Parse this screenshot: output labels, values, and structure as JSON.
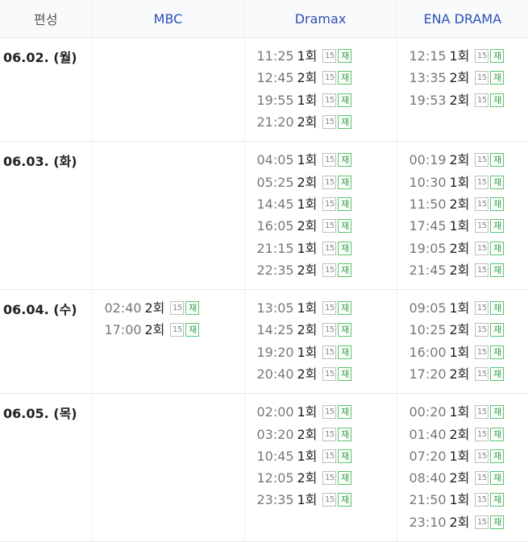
{
  "header": {
    "program": "편성",
    "channels": [
      "MBC",
      "Dramax",
      "ENA DRAMA"
    ]
  },
  "rows": [
    {
      "date": "06.02. (월)",
      "cells": [
        [],
        [
          {
            "time": "11:25",
            "ep": "1회",
            "age": "15",
            "rerun": "재"
          },
          {
            "time": "12:45",
            "ep": "2회",
            "age": "15",
            "rerun": "재"
          },
          {
            "time": "19:55",
            "ep": "1회",
            "age": "15",
            "rerun": "재"
          },
          {
            "time": "21:20",
            "ep": "2회",
            "age": "15",
            "rerun": "재"
          }
        ],
        [
          {
            "time": "12:15",
            "ep": "1회",
            "age": "15",
            "rerun": "재"
          },
          {
            "time": "13:35",
            "ep": "2회",
            "age": "15",
            "rerun": "재"
          },
          {
            "time": "19:53",
            "ep": "2회",
            "age": "15",
            "rerun": "재"
          }
        ]
      ]
    },
    {
      "date": "06.03. (화)",
      "cells": [
        [],
        [
          {
            "time": "04:05",
            "ep": "1회",
            "age": "15",
            "rerun": "재"
          },
          {
            "time": "05:25",
            "ep": "2회",
            "age": "15",
            "rerun": "재"
          },
          {
            "time": "14:45",
            "ep": "1회",
            "age": "15",
            "rerun": "재"
          },
          {
            "time": "16:05",
            "ep": "2회",
            "age": "15",
            "rerun": "재"
          },
          {
            "time": "21:15",
            "ep": "1회",
            "age": "15",
            "rerun": "재"
          },
          {
            "time": "22:35",
            "ep": "2회",
            "age": "15",
            "rerun": "재"
          }
        ],
        [
          {
            "time": "00:19",
            "ep": "2회",
            "age": "15",
            "rerun": "재"
          },
          {
            "time": "10:30",
            "ep": "1회",
            "age": "15",
            "rerun": "재"
          },
          {
            "time": "11:50",
            "ep": "2회",
            "age": "15",
            "rerun": "재"
          },
          {
            "time": "17:45",
            "ep": "1회",
            "age": "15",
            "rerun": "재"
          },
          {
            "time": "19:05",
            "ep": "2회",
            "age": "15",
            "rerun": "재"
          },
          {
            "time": "21:45",
            "ep": "2회",
            "age": "15",
            "rerun": "재"
          }
        ]
      ]
    },
    {
      "date": "06.04. (수)",
      "cells": [
        [
          {
            "time": "02:40",
            "ep": "2회",
            "age": "15",
            "rerun": "재"
          },
          {
            "time": "17:00",
            "ep": "2회",
            "age": "15",
            "rerun": "재"
          }
        ],
        [
          {
            "time": "13:05",
            "ep": "1회",
            "age": "15",
            "rerun": "재"
          },
          {
            "time": "14:25",
            "ep": "2회",
            "age": "15",
            "rerun": "재"
          },
          {
            "time": "19:20",
            "ep": "1회",
            "age": "15",
            "rerun": "재"
          },
          {
            "time": "20:40",
            "ep": "2회",
            "age": "15",
            "rerun": "재"
          }
        ],
        [
          {
            "time": "09:05",
            "ep": "1회",
            "age": "15",
            "rerun": "재"
          },
          {
            "time": "10:25",
            "ep": "2회",
            "age": "15",
            "rerun": "재"
          },
          {
            "time": "16:00",
            "ep": "1회",
            "age": "15",
            "rerun": "재"
          },
          {
            "time": "17:20",
            "ep": "2회",
            "age": "15",
            "rerun": "재"
          }
        ]
      ]
    },
    {
      "date": "06.05. (목)",
      "cells": [
        [],
        [
          {
            "time": "02:00",
            "ep": "1회",
            "age": "15",
            "rerun": "재"
          },
          {
            "time": "03:20",
            "ep": "2회",
            "age": "15",
            "rerun": "재"
          },
          {
            "time": "10:45",
            "ep": "1회",
            "age": "15",
            "rerun": "재"
          },
          {
            "time": "12:05",
            "ep": "2회",
            "age": "15",
            "rerun": "재"
          },
          {
            "time": "23:35",
            "ep": "1회",
            "age": "15",
            "rerun": "재"
          }
        ],
        [
          {
            "time": "00:20",
            "ep": "1회",
            "age": "15",
            "rerun": "재"
          },
          {
            "time": "01:40",
            "ep": "2회",
            "age": "15",
            "rerun": "재"
          },
          {
            "time": "07:20",
            "ep": "1회",
            "age": "15",
            "rerun": "재"
          },
          {
            "time": "08:40",
            "ep": "2회",
            "age": "15",
            "rerun": "재"
          },
          {
            "time": "21:50",
            "ep": "1회",
            "age": "15",
            "rerun": "재"
          },
          {
            "time": "23:10",
            "ep": "2회",
            "age": "15",
            "rerun": "재"
          }
        ]
      ]
    }
  ]
}
